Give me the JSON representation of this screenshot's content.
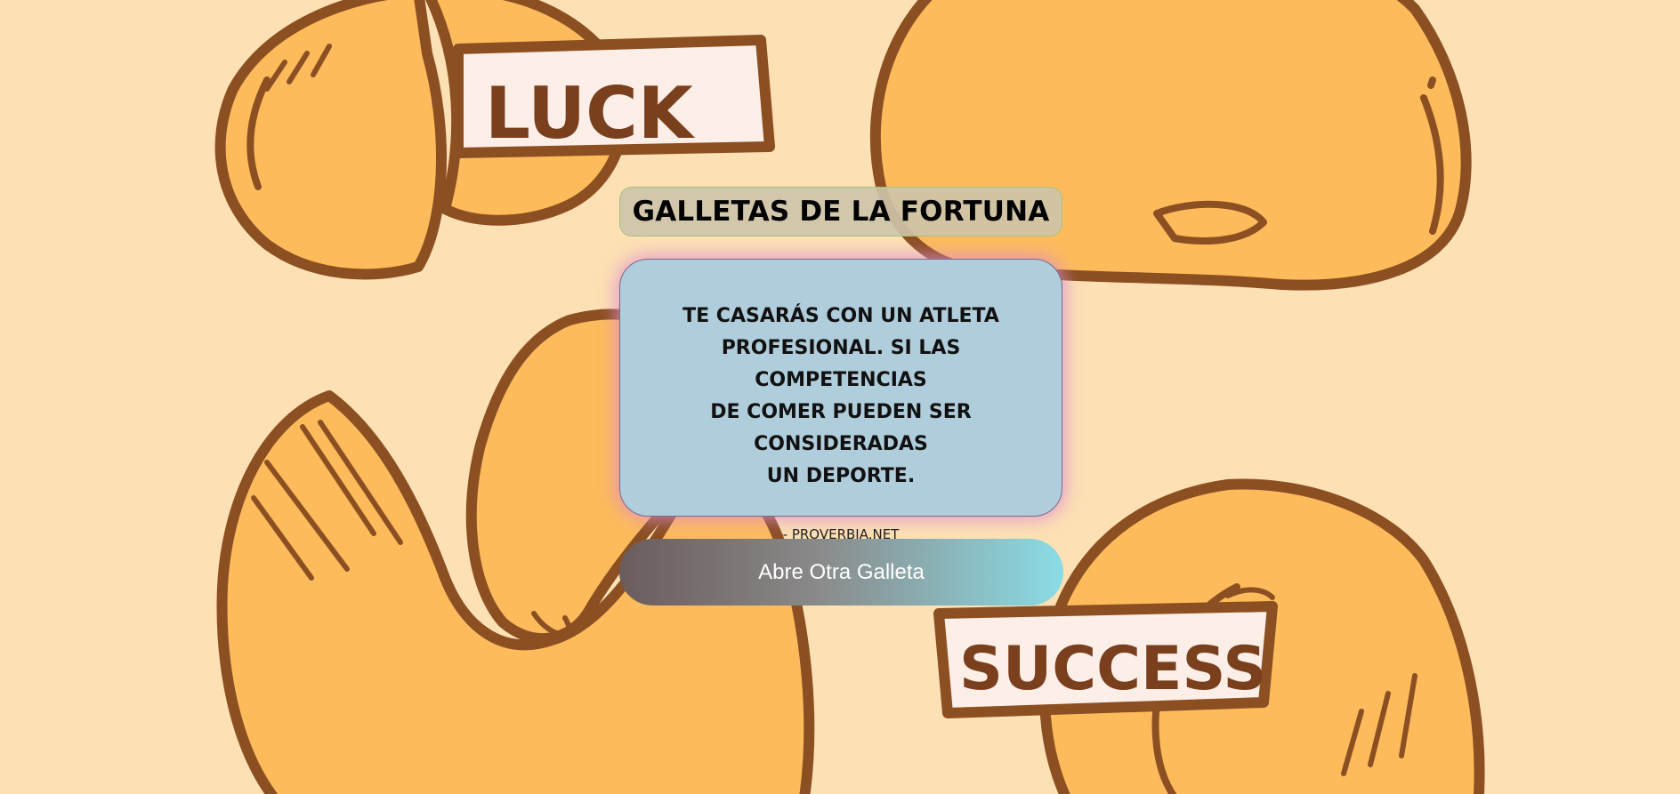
{
  "background": {
    "banner_top": "LUCK",
    "banner_bottom": "SUCCESS",
    "colors": {
      "page": "#fde0b4",
      "cookie_fill": "#fdbb5c",
      "cookie_outline": "#8c4f22",
      "banner_fill": "#fdeee8"
    }
  },
  "header": {
    "title": "GALLETAS DE LA FORTUNA"
  },
  "fortune": {
    "lines": [
      "TE CASARÁS CON UN ATLETA",
      "PROFESIONAL. SI LAS COMPETENCIAS",
      "DE COMER PUEDEN SER CONSIDERADAS",
      "UN DEPORTE."
    ],
    "author": "- PROVERBIA.NET"
  },
  "actions": {
    "open_label": "Abre Otra Galleta"
  }
}
